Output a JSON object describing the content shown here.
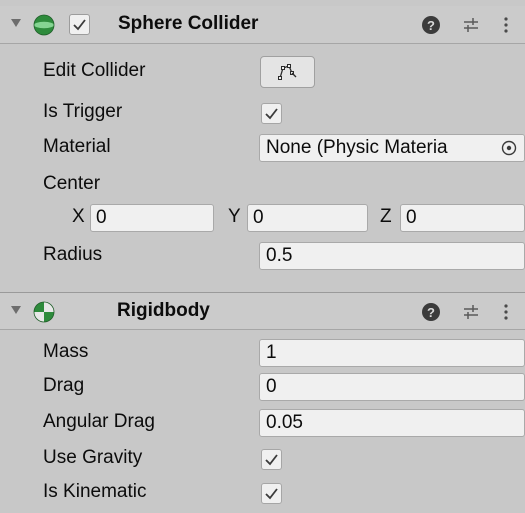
{
  "sphere_collider": {
    "title": "Sphere Collider",
    "enabled": true,
    "edit_collider_label": "Edit Collider",
    "is_trigger_label": "Is Trigger",
    "is_trigger": true,
    "material_label": "Material",
    "material_value": "None (Physic Materia",
    "center_label": "Center",
    "center": {
      "x_label": "X",
      "x": "0",
      "y_label": "Y",
      "y": "0",
      "z_label": "Z",
      "z": "0"
    },
    "radius_label": "Radius",
    "radius": "0.5"
  },
  "rigidbody": {
    "title": "Rigidbody",
    "mass_label": "Mass",
    "mass": "1",
    "drag_label": "Drag",
    "drag": "0",
    "angular_drag_label": "Angular Drag",
    "angular_drag": "0.05",
    "use_gravity_label": "Use Gravity",
    "use_gravity": true,
    "is_kinematic_label": "Is Kinematic",
    "is_kinematic": true
  },
  "header_icons": {
    "help": "?",
    "preset": "preset-icon",
    "menu": "menu-icon"
  },
  "colors": {
    "sphere_icon": "#2e8b3c",
    "rigidbody_icon": "#2e8b3c",
    "check": "#3b3b3b"
  }
}
